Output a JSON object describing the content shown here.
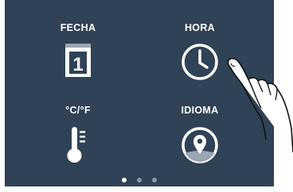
{
  "tiles": {
    "date": {
      "label": "FECHA",
      "icon": "calendar-icon",
      "day": "1"
    },
    "time": {
      "label": "HORA",
      "icon": "clock-icon"
    },
    "units": {
      "label": "°C/°F",
      "icon": "thermometer-icon"
    },
    "language": {
      "label": "IDIOMA",
      "icon": "location-pin-icon"
    }
  },
  "pagination": {
    "pages": 3,
    "current": 1
  },
  "colors": {
    "screen_background": "#2f4256",
    "foreground": "#ffffff",
    "dot_inactive": "#8b98a6"
  },
  "overlay": {
    "icon": "pointing-hand-icon"
  }
}
